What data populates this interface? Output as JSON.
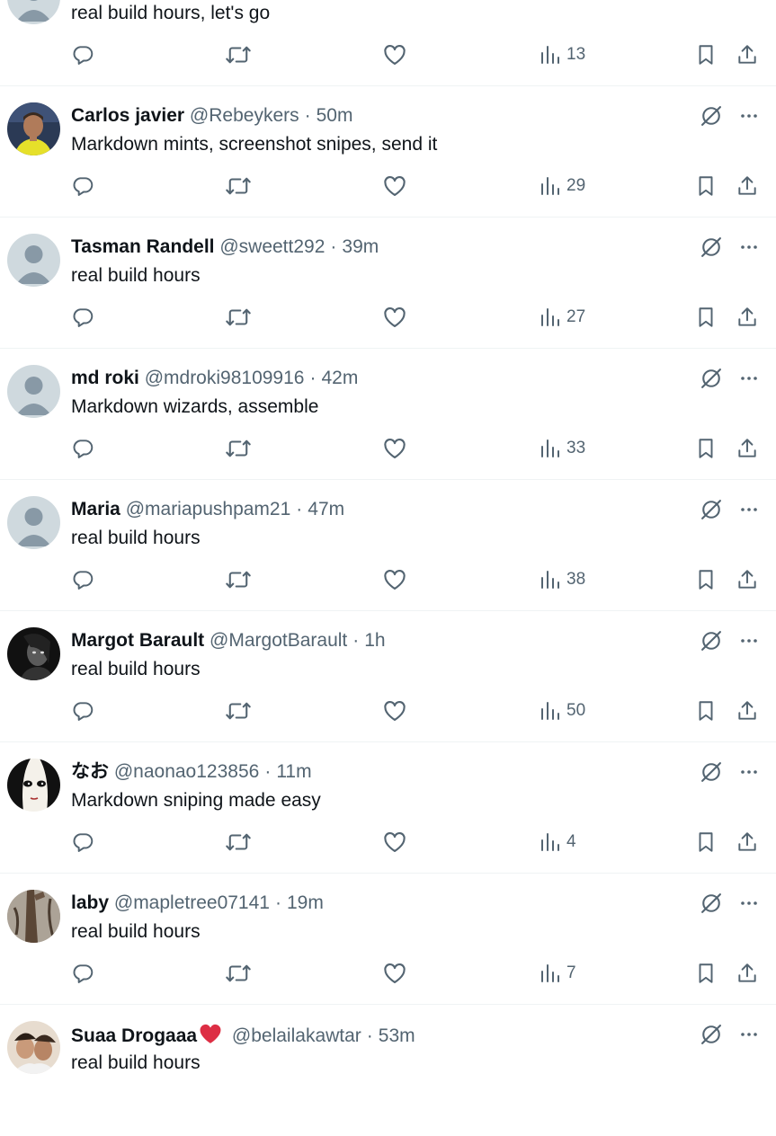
{
  "first_post": {
    "text": "real build hours, let's go",
    "views": "13"
  },
  "posts": [
    {
      "name": "Carlos javier",
      "handle": "@Rebeykers",
      "time": "50m",
      "text": "Markdown mints, screenshot snipes, send it",
      "views": "29",
      "avatar": "photo-man-yellow-shirt"
    },
    {
      "name": "Tasman Randell",
      "handle": "@sweett292",
      "time": "39m",
      "text": "real build hours",
      "views": "27",
      "avatar": "default"
    },
    {
      "name": "md roki",
      "handle": "@mdroki98109916",
      "time": "42m",
      "text": "Markdown wizards, assemble",
      "views": "33",
      "avatar": "default"
    },
    {
      "name": "Maria",
      "handle": "@mariapushpam21",
      "time": "47m",
      "text": "real build hours",
      "views": "38",
      "avatar": "default"
    },
    {
      "name": "Margot Barault",
      "handle": "@MargotBarault",
      "time": "1h",
      "text": "real build hours",
      "views": "50",
      "avatar": "photo-dark-portrait"
    },
    {
      "name": "なお",
      "handle": "@naonao123856",
      "time": "11m",
      "text": "Markdown sniping made easy",
      "views": "4",
      "avatar": "anime-face"
    },
    {
      "name": "laby",
      "handle": "@mapletree07141",
      "time": "19m",
      "text": "real build hours",
      "views": "7",
      "avatar": "photo-tree"
    },
    {
      "name": "Suaa Drogaaa",
      "name_emoji": "red-heart",
      "handle": "@belailakawtar",
      "time": "53m",
      "text": "real build hours",
      "avatar": "photo-selfie"
    }
  ],
  "colors": {
    "text": "#0f1419",
    "secondary": "#536471",
    "divider": "#eff3f4",
    "default_avatar_bg": "#cfd9de",
    "heart": "#e0245e"
  },
  "icons": {
    "reply": "reply-icon",
    "retweet": "retweet-icon",
    "like": "like-icon",
    "views": "views-icon",
    "bookmark": "bookmark-icon",
    "share": "share-icon",
    "grok": "grok-icon",
    "more": "more-icon"
  }
}
